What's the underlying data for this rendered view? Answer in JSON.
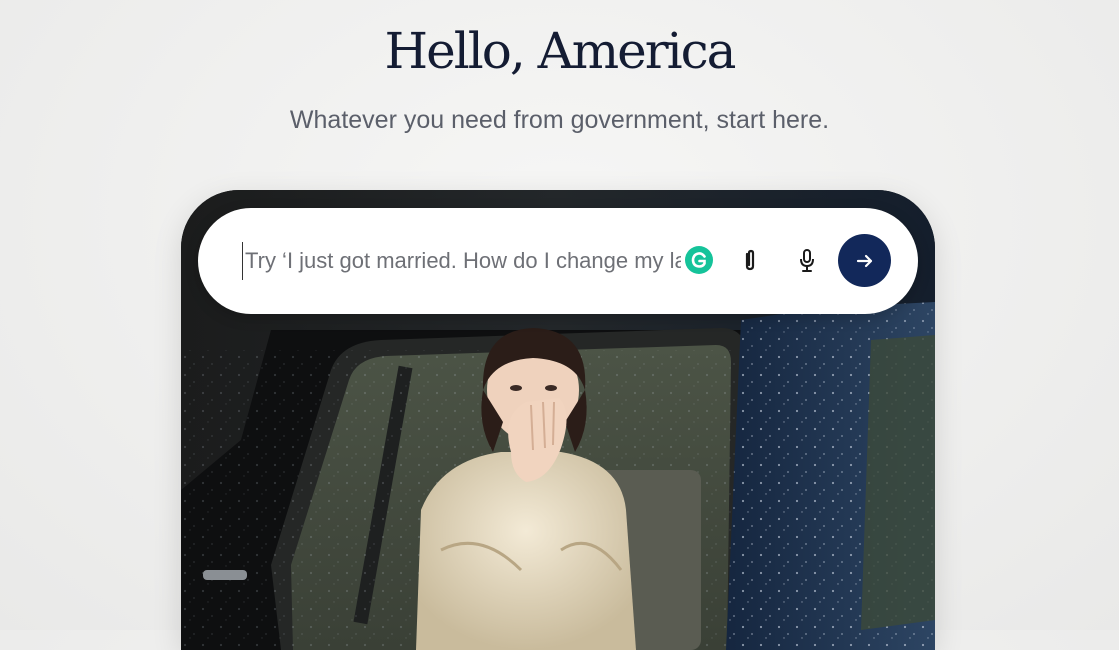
{
  "hero": {
    "title": "Hello, America",
    "subtitle": "Whatever you need from government, start here."
  },
  "search": {
    "placeholder": "Try ‘I just got married. How do I change my last name?’",
    "value": ""
  },
  "icons": {
    "grammarly": "grammarly-icon",
    "attach": "paperclip-icon",
    "mic": "microphone-icon",
    "submit": "arrow-right-icon"
  },
  "colors": {
    "heading": "#141c33",
    "subtitle": "#5b5f6a",
    "submit_button": "#12285a",
    "grammarly": "#15c39a"
  }
}
